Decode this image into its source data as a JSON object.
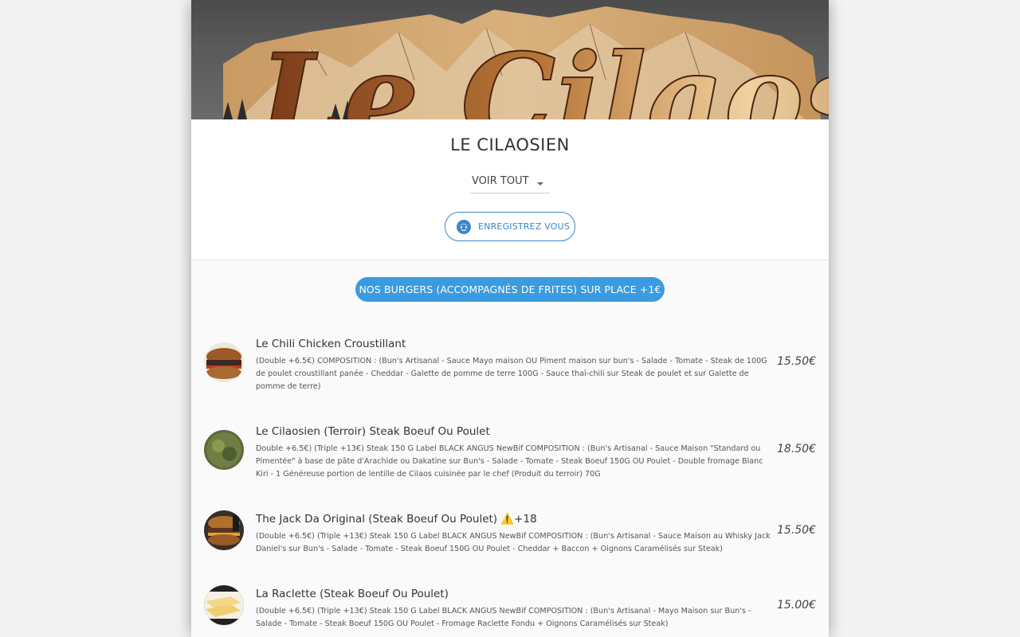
{
  "restaurant": {
    "title": "LE CILAOSIEN"
  },
  "filter": {
    "selected": "VOIR TOUT"
  },
  "register_button": {
    "label": "ENREGISTREZ VOUS"
  },
  "category": {
    "label": "NOS BURGERS (ACCOMPAGNÉS DE FRITES) SUR PLACE +1€"
  },
  "items": [
    {
      "name": "Le Chili Chicken Croustillant",
      "description": "(Double +6.5€) COMPOSITION : (Bun's Artisanal - Sauce Mayo maison OU Piment maison sur bun's - Salade - Tomate - Steak de 100G de poulet croustillant panée  - Cheddar - Galette de pomme de terre 100G - Sauce thaï-chili sur Steak de poulet et sur Galette de pomme de terre)",
      "price": "15.50€"
    },
    {
      "name": "Le Cilaosien (Terroir) Steak Boeuf Ou Poulet",
      "description": "Double +6.5€) (Triple +13€) Steak 150 G Label BLACK ANGUS NewBif COMPOSITION : (Bun's Artisanal - Sauce Maison \"Standard ou Pimentée\" à base de pâte d'Arachide ou Dakatine sur Bun's - Salade - Tomate - Steak Boeuf 150G OU Poulet - Double fromage Blanc Kiri - 1 Généreuse portion de lentille de Cilaos cuisinée par le chef (Produit du terroir) 70G",
      "price": "18.50€"
    },
    {
      "name": "The Jack Da Original (Steak Boeuf Ou Poulet) ⚠️+18",
      "description": "(Double +6.5€) (Triple +13€) Steak 150 G Label BLACK ANGUS NewBif COMPOSITION : (Bun's Artisanal - Sauce Maison au Whisky Jack Daniel's sur Bun's - Salade - Tomate - Steak Boeuf 150G OU Poulet - Cheddar + Baccon + Oignons Caramélisés sur Steak)",
      "price": "15.50€"
    },
    {
      "name": "La Raclette (Steak Boeuf Ou Poulet)",
      "description": "(Double +6.5€) (Triple +13€) Steak 150 G Label BLACK ANGUS NewBif COMPOSITION : (Bun's Artisanal - Mayo Maison sur Bun's - Salade - Tomate - Steak Boeuf 150G OU Poulet - Fromage Raclette Fondu + Oignons Caramélisés sur Steak)",
      "price": "15.00€"
    }
  ],
  "colors": {
    "accent": "#3a9be0",
    "outline_blue": "#3a86c8"
  }
}
